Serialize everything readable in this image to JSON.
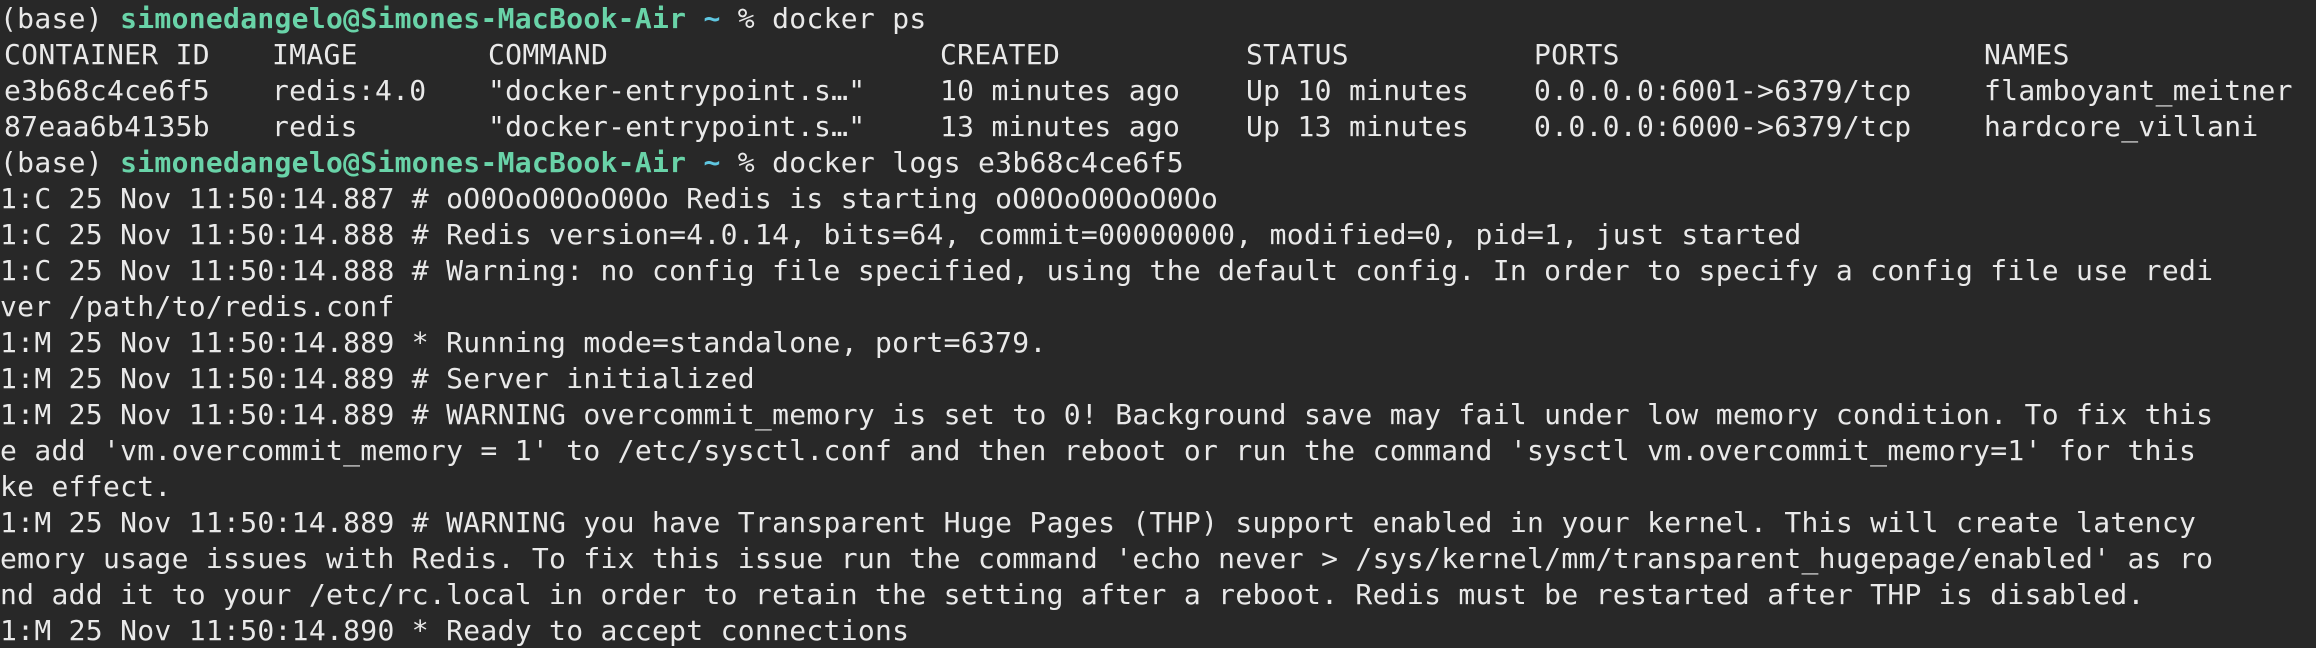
{
  "terminal": {
    "prompt1": {
      "env": "(base) ",
      "user_host": "simonedangelo@Simones-MacBook-Air",
      "tilde": " ~ ",
      "symbol": "% ",
      "command": "docker ps"
    },
    "ps_headers": [
      "CONTAINER ID",
      "IMAGE",
      "COMMAND",
      "CREATED",
      "STATUS",
      "PORTS",
      "NAMES"
    ],
    "ps_rows": [
      [
        "e3b68c4ce6f5",
        "redis:4.0",
        "\"docker-entrypoint.s…\"",
        "10 minutes ago",
        "Up 10 minutes",
        "0.0.0.0:6001->6379/tcp",
        "flamboyant_meitner"
      ],
      [
        "87eaa6b4135b",
        "redis",
        "\"docker-entrypoint.s…\"",
        "13 minutes ago",
        "Up 13 minutes",
        "0.0.0.0:6000->6379/tcp",
        "hardcore_villani"
      ]
    ],
    "prompt2": {
      "env": "(base) ",
      "user_host": "simonedangelo@Simones-MacBook-Air",
      "tilde": " ~ ",
      "symbol": "% ",
      "command": "docker logs e3b68c4ce6f5"
    },
    "log_lines": [
      "1:C 25 Nov 11:50:14.887 # oO0OoO0OoO0Oo Redis is starting oO0OoO0OoO0Oo",
      "1:C 25 Nov 11:50:14.888 # Redis version=4.0.14, bits=64, commit=00000000, modified=0, pid=1, just started",
      "1:C 25 Nov 11:50:14.888 # Warning: no config file specified, using the default config. In order to specify a config file use redi",
      "ver /path/to/redis.conf",
      "1:M 25 Nov 11:50:14.889 * Running mode=standalone, port=6379.",
      "1:M 25 Nov 11:50:14.889 # Server initialized",
      "1:M 25 Nov 11:50:14.889 # WARNING overcommit_memory is set to 0! Background save may fail under low memory condition. To fix this",
      "e add 'vm.overcommit_memory = 1' to /etc/sysctl.conf and then reboot or run the command 'sysctl vm.overcommit_memory=1' for this",
      "ke effect.",
      "1:M 25 Nov 11:50:14.889 # WARNING you have Transparent Huge Pages (THP) support enabled in your kernel. This will create latency",
      "emory usage issues with Redis. To fix this issue run the command 'echo never > /sys/kernel/mm/transparent_hugepage/enabled' as ro",
      "nd add it to your /etc/rc.local in order to retain the setting after a reboot. Redis must be restarted after THP is disabled.",
      "1:M 25 Nov 11:50:14.890 * Ready to accept connections"
    ]
  }
}
